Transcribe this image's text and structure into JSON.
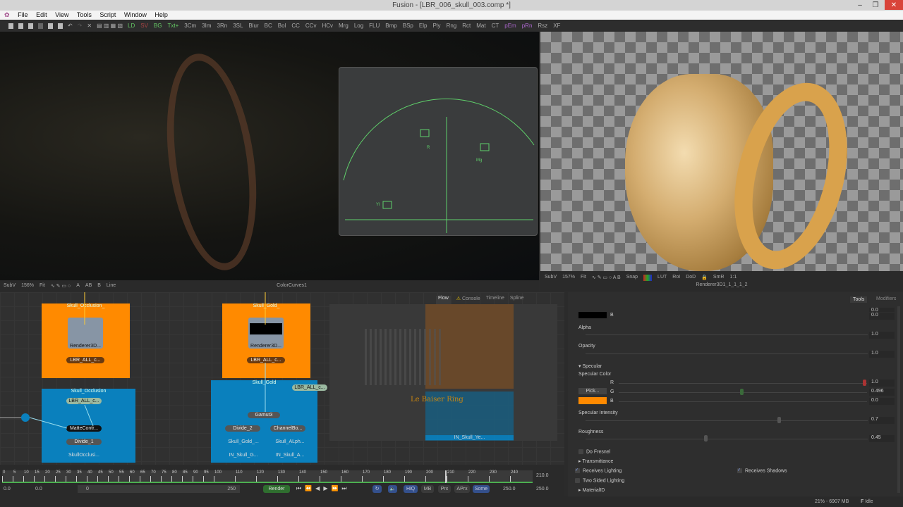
{
  "window": {
    "title": "Fusion - [LBR_006_skull_003.comp *]",
    "minimize": "–",
    "maximize": "❐",
    "close": "✕"
  },
  "menu": [
    "File",
    "Edit",
    "View",
    "Tools",
    "Script",
    "Window",
    "Help"
  ],
  "toolbar": [
    "LD",
    "SV",
    "BG",
    "Txt+",
    "3Cm",
    "3Im",
    "3Rn",
    "3SL",
    "Blur",
    "BC",
    "Bol",
    "CC",
    "CCv",
    "HCv",
    "Mrg",
    "Log",
    "FLU",
    "Bmp",
    "BSp",
    "Elp",
    "Ply",
    "Rng",
    "Rct",
    "Mat",
    "CT",
    "pEm",
    "pRn",
    "Rsz",
    "XF"
  ],
  "viewer_left": {
    "subv": "SubV",
    "zoom": "156%",
    "fit": "Fit",
    "tools": [
      "A",
      "AB",
      "B"
    ],
    "mode": "Line",
    "node": "ColorCurves1",
    "scope_labels": [
      "R",
      "Mg",
      "YI"
    ]
  },
  "viewer_right": {
    "subv": "SubV",
    "zoom": "157%",
    "fit": "Fit",
    "snap": "Snap",
    "lut": "LUT",
    "roi": "RoI",
    "dod": "DoD",
    "smr": "SmR",
    "ratio": "1:1",
    "node": "Renderer3D1_1_1_1_2"
  },
  "flow_tabs": [
    "Flow",
    "Console",
    "Timeline",
    "Spline"
  ],
  "nodes": {
    "grp1_title": "Skull_Occlusion_",
    "grp1_renderer": "Renderer3D...",
    "grp1_loader": "LBR_ALL_c...",
    "grp2_title": "Skull_Occlusion",
    "grp2_loader": "LBR_ALL_c...",
    "grp2_matte": "MatteContr...",
    "grp2_divide": "Divide_1",
    "grp2_saver": "SkullOcclusi...",
    "grp3_title": "Skull_Gold_",
    "grp3_renderer": "Renderer3D...",
    "grp3_loader": "LBR_ALL_c...",
    "grp4_title": "Skull_Gold",
    "grp4_loader": "LBR_ALL_c...",
    "grp4_gamut": "Gamut3",
    "grp4_divide": "Divide_2",
    "grp4_channel": "ChannelBo...",
    "grp4_saver1": "Skull_Gold_...",
    "grp4_saver2": "Skull_ALph...",
    "grp4_in1": "IN_Skull_G...",
    "grp4_in2": "IN_Skull_A...",
    "minimap_label": "Le Baiser Ring",
    "minimap_node": "IN_Skull_Ye..."
  },
  "inspector": {
    "tabs": [
      "Tools",
      "Modifiers"
    ],
    "top_b_label": "B",
    "top_b_value": "0.0",
    "top_g_value": "0.0",
    "alpha_label": "Alpha",
    "alpha_value": "1.0",
    "opacity_label": "Opacity",
    "opacity_value": "1.0",
    "specular_section": "Specular",
    "specular_color_label": "Specular Color",
    "r_label": "R",
    "r_value": "1.0",
    "g_label": "G",
    "g_value": "0.496",
    "b_label": "B",
    "b_value": "0.0",
    "pick": "Pick...",
    "swatch_color": "#ff8a00",
    "intensity_label": "Specular Intensity",
    "intensity_value": "0.7",
    "roughness_label": "Roughness",
    "roughness_value": "0.45",
    "do_fresnel": "Do Fresnel",
    "transmittance": "Transmittance",
    "receives_lighting": "Receives Lighting",
    "receives_shadows": "Receives Shadows",
    "two_sided": "Two Sided Lighting",
    "material_id": "MaterialID"
  },
  "timeline": {
    "ticks": [
      0,
      5,
      10,
      15,
      20,
      25,
      30,
      35,
      40,
      45,
      50,
      55,
      60,
      65,
      70,
      75,
      80,
      85,
      90,
      95,
      100,
      110,
      120,
      130,
      140,
      150,
      160,
      170,
      180,
      190,
      200,
      210,
      220,
      230,
      240
    ],
    "current": "210.0",
    "start": "0.0",
    "start2": "0.0",
    "range_start": "0",
    "range_end": "250",
    "end": "250.0",
    "end2": "250.0",
    "render": "Render",
    "buttons": [
      "HiQ",
      "MB",
      "Prx",
      "APrx",
      "Some"
    ]
  },
  "status": {
    "memory": "21% - 6907 MB",
    "state": "Idle"
  }
}
